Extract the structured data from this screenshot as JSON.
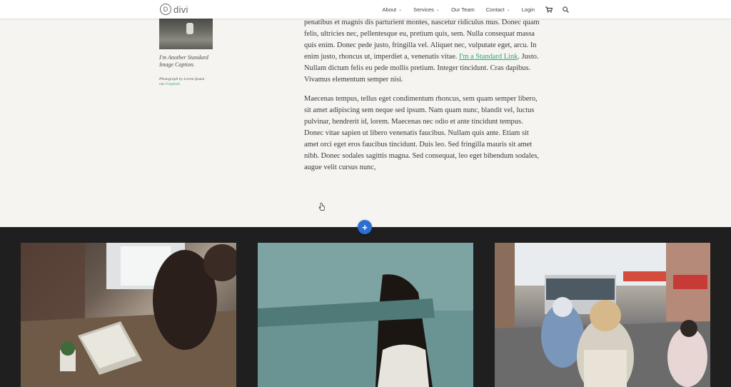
{
  "header": {
    "logo_mark": "D",
    "logo_text": "divi",
    "nav": [
      {
        "label": "About",
        "has_dropdown": true
      },
      {
        "label": "Services",
        "has_dropdown": true
      },
      {
        "label": "Our Team",
        "has_dropdown": false
      },
      {
        "label": "Contact",
        "has_dropdown": true
      },
      {
        "label": "Login",
        "has_dropdown": false
      }
    ],
    "cart_icon": "cart-icon",
    "search_icon": "search-icon"
  },
  "sidebar_figure": {
    "caption_title": "I'm Another Standard Image Caption.",
    "credit_prefix": "Photograph by Lorem Ipsum via ",
    "credit_link": "Unsplash"
  },
  "article": {
    "p1_before_link": "penatibus et magnis dis parturient montes, nascetur ridiculus mus. Donec quam felis, ultricies nec, pellentesque eu, pretium quis, sem. Nulla consequat massa quis enim. Donec pede justo, fringilla vel. Aliquet nec, vulputate eget, arcu. In enim justo, rhoncus ut, imperdiet a, venenatis vitae. ",
    "p1_link": "I'm a Standard Link",
    "p1_after_link": ". Justo. Nullam dictum felis eu pede mollis pretium. Integer tincidunt. Cras dapibus. Vivamus elementum semper nisi.",
    "p2": "Maecenas tempus, tellus eget condimentum rhoncus, sem quam semper libero, sit amet adipiscing sem neque sed ipsum. Nam quam nunc, blandit vel, luctus pulvinar, hendrerit id, lorem. Maecenas nec odio et ante tincidunt tempus. Donec vitae sapien ut libero venenatis faucibus. Nullam quis ante. Etiam sit amet orci eget eros faucibus tincidunt. Duis leo. Sed fringilla mauris sit amet nibh. Donec sodales sagittis magna. Sed consequat, leo eget bibendum sodales, augue velit cursus nunc,"
  },
  "builder": {
    "add_button": "+"
  },
  "colors": {
    "accent_link": "#2aa87a",
    "add_button": "#2d6fd1",
    "dark_section": "#1f1f1f"
  }
}
